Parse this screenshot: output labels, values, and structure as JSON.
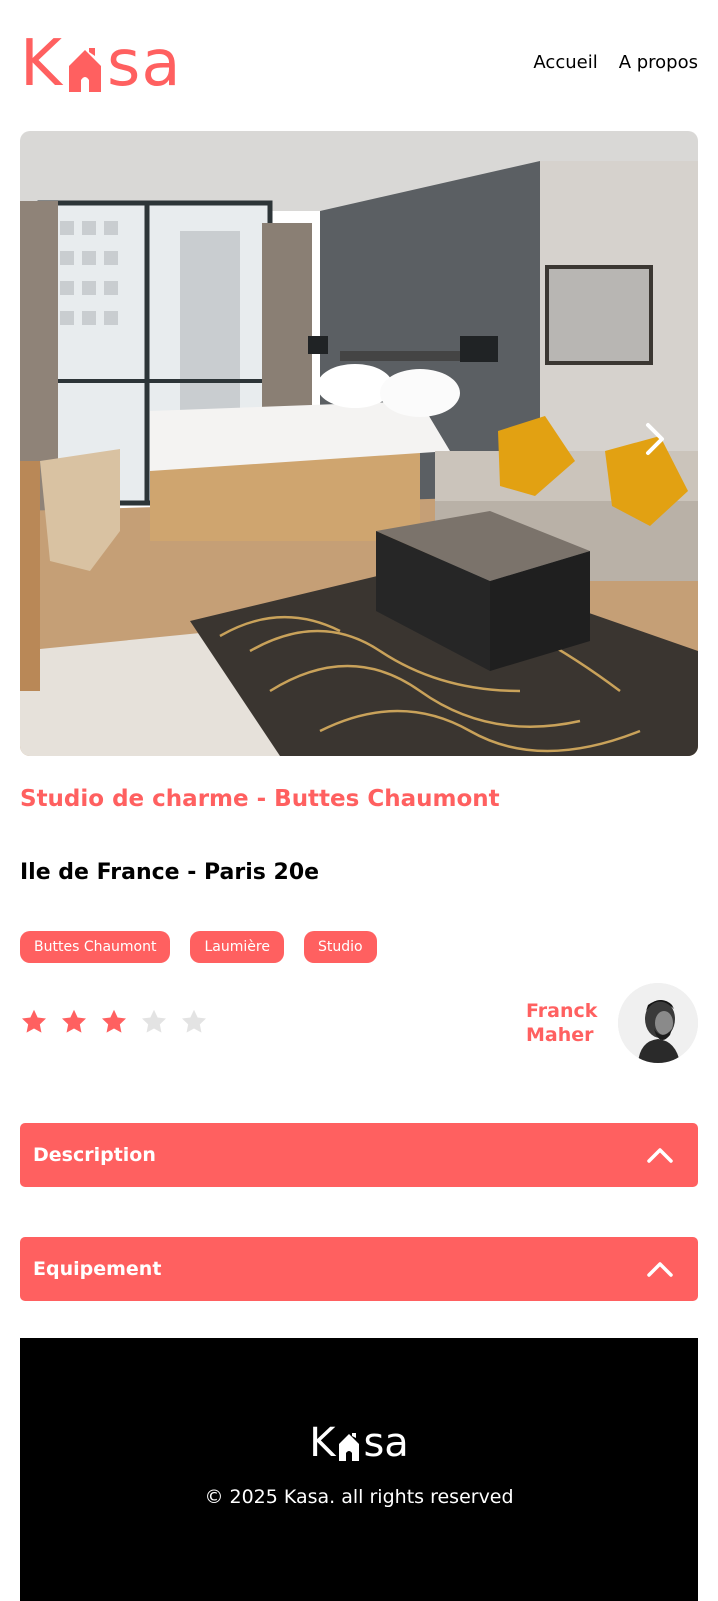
{
  "brand": {
    "logo_text_left": "K",
    "logo_text_right": "sa",
    "logo_icon": "house-icon",
    "accent_color": "#FF6060"
  },
  "nav": {
    "home_label": "Accueil",
    "about_label": "A propos"
  },
  "carousel": {
    "next_icon": "chevron-right-icon"
  },
  "listing": {
    "title": "Studio de charme - Buttes Chaumont",
    "location": "Ile de France - Paris 20e",
    "tags": [
      "Buttes Chaumont",
      "Laumière",
      "Studio"
    ],
    "rating": 3,
    "rating_max": 5,
    "host": {
      "first_name": "Franck",
      "last_name": "Maher"
    }
  },
  "collapses": [
    {
      "title": "Description",
      "icon": "chevron-up-icon"
    },
    {
      "title": "Equipement",
      "icon": "chevron-up-icon"
    }
  ],
  "footer": {
    "logo_text_left": "K",
    "logo_text_right": "sa",
    "copyright": "© 2025 Kasa. all rights reserved"
  }
}
